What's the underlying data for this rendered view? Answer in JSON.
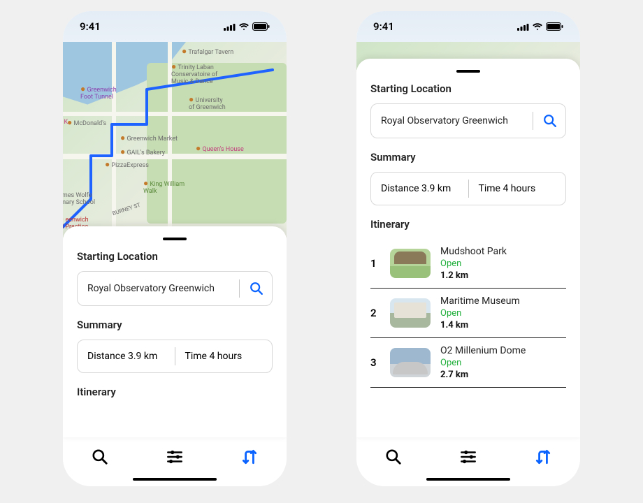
{
  "status": {
    "time": "9:41"
  },
  "sections": {
    "starting": "Starting Location",
    "summary": "Summary",
    "itinerary": "Itinerary"
  },
  "search": {
    "value": "Royal Observatory Greenwich"
  },
  "summary": {
    "distance_label": "Distance",
    "distance_value": "3.9 km",
    "time_label": "Time",
    "time_value": "4 hours"
  },
  "itinerary": [
    {
      "n": "1",
      "name": "Mudshoot Park",
      "status": "Open",
      "dist": "1.2 km"
    },
    {
      "n": "2",
      "name": "Maritime Museum",
      "status": "Open",
      "dist": "1.4 km"
    },
    {
      "n": "3",
      "name": "O2 Millenium Dome",
      "status": "Open",
      "dist": "2.7 km"
    }
  ],
  "map_pois": {
    "trafalgar": "Trafalgar Tavern",
    "trinity": "Trinity Laban\nConservatoire of\nMusic & Dance",
    "foot_tunnel": "Greenwich\nFoot Tunnel",
    "university": "University\nof Greenwich",
    "mcdonalds": "McDonald's",
    "market": "Greenwich Market",
    "gails": "GAIL's Bakery",
    "pizza": "PizzaExpress",
    "queens": "Queen's House",
    "kww": "King William\nWalk",
    "wolfe": "ames Wolfe\nimary School",
    "practice": "eenwich\nal Practice",
    "burney": "BURNEY ST"
  }
}
